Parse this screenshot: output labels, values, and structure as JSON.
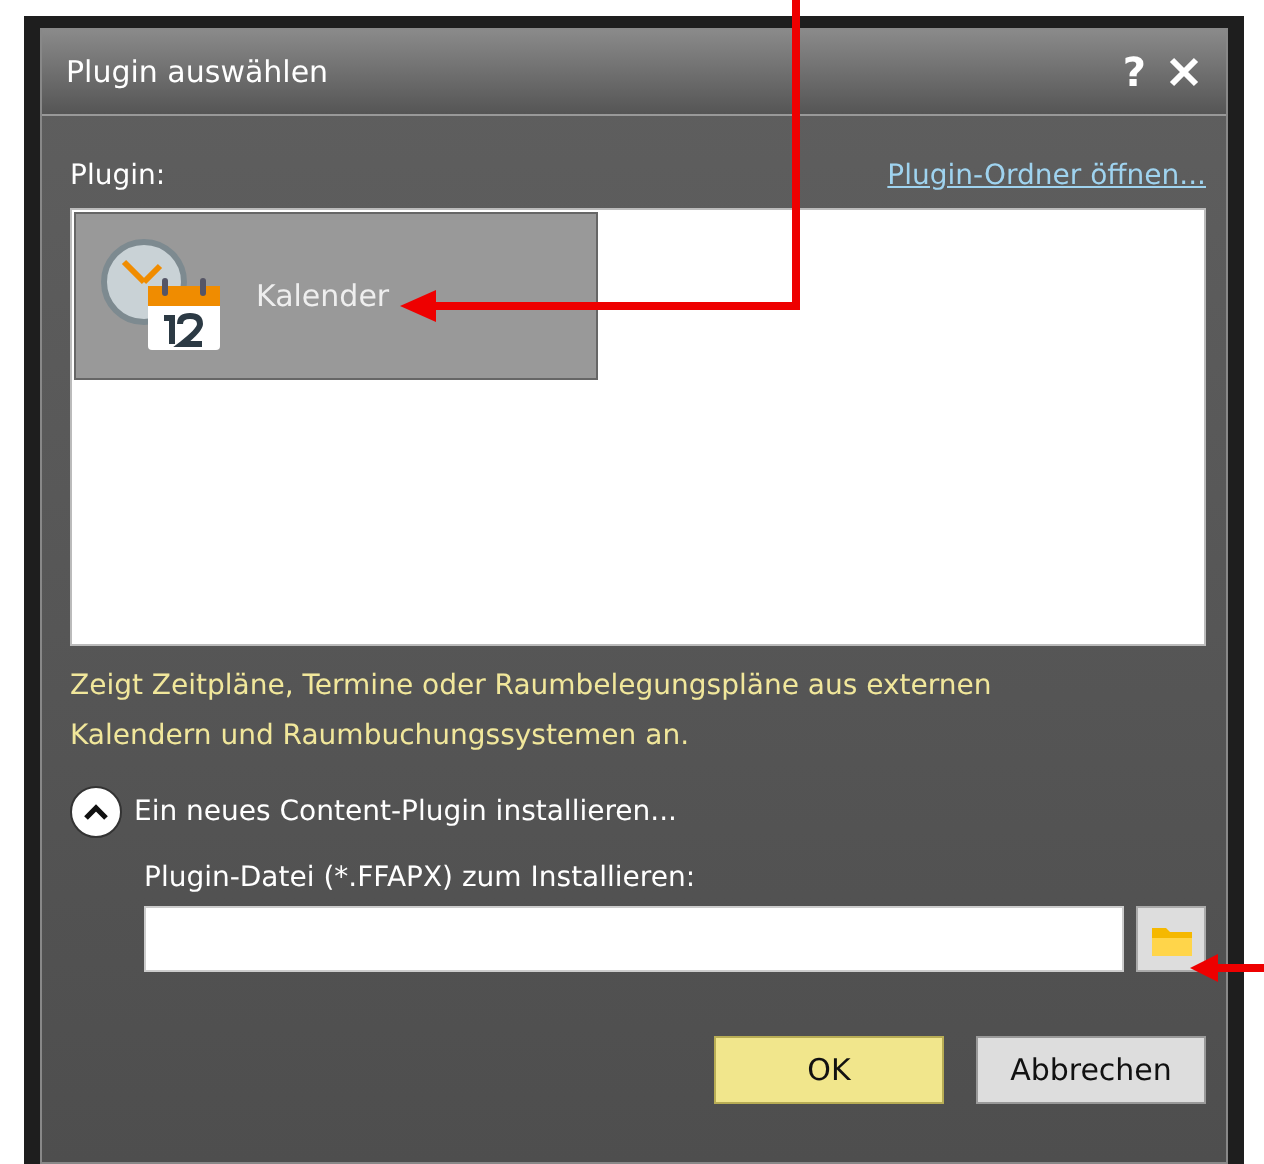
{
  "window": {
    "title": "Plugin auswählen",
    "help": "?"
  },
  "plugin_label": "Plugin:",
  "folder_link": "Plugin-Ordner öffnen...",
  "plugins": [
    {
      "name": "Kalender",
      "selected": true
    }
  ],
  "description": "Zeigt Zeitpläne, Termine oder Raumbelegungspläne aus externen Kalendern und Raumbuchungssystemen an.",
  "install": {
    "label": "Ein neues Content-Plugin installieren...",
    "expanded": true,
    "file_label": "Plugin-Datei (*.FFAPX) zum Installieren:"
  },
  "buttons": [
    {
      "label": "OK",
      "kind": "default"
    },
    {
      "label": "Abbrechen",
      "kind": "normal"
    }
  ]
}
